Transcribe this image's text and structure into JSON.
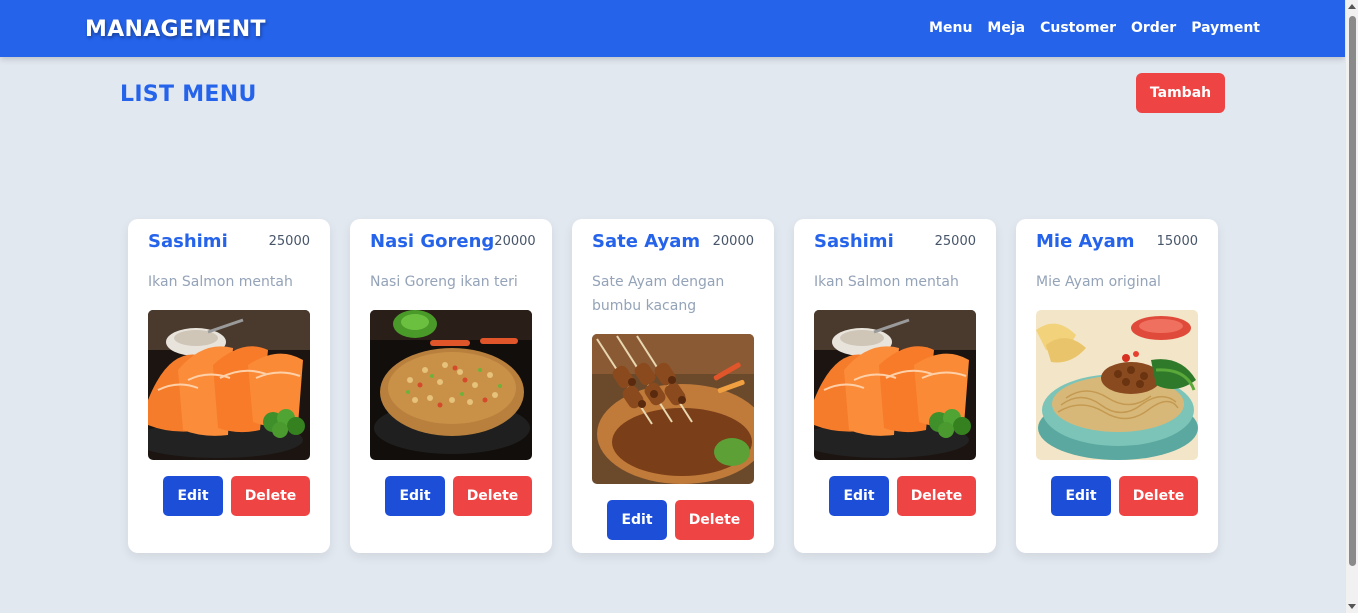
{
  "navbar": {
    "brand": "MANAGEMENT",
    "links": [
      "Menu",
      "Meja",
      "Customer",
      "Order",
      "Payment"
    ]
  },
  "page": {
    "title": "LIST MENU",
    "add_label": "Tambah"
  },
  "menu_items": [
    {
      "name": "Sashimi",
      "price": "25000",
      "description": "Ikan Salmon mentah",
      "image": "salmon-sashimi",
      "edit_label": "Edit",
      "delete_label": "Delete"
    },
    {
      "name": "Nasi Goreng",
      "price": "20000",
      "description": "Nasi Goreng ikan teri",
      "image": "fried-rice",
      "edit_label": "Edit",
      "delete_label": "Delete"
    },
    {
      "name": "Sate Ayam",
      "price": "20000",
      "description": "Sate Ayam dengan bumbu kacang",
      "image": "chicken-satay",
      "edit_label": "Edit",
      "delete_label": "Delete"
    },
    {
      "name": "Sashimi",
      "price": "25000",
      "description": "Ikan Salmon mentah",
      "image": "salmon-sashimi",
      "edit_label": "Edit",
      "delete_label": "Delete"
    },
    {
      "name": "Mie Ayam",
      "price": "15000",
      "description": "Mie Ayam original",
      "image": "chicken-noodles",
      "edit_label": "Edit",
      "delete_label": "Delete"
    }
  ],
  "colors": {
    "navbar": "#2563eb",
    "background": "#e2e8f0",
    "title": "#2563eb",
    "danger": "#ef4444",
    "edit": "#1d4ed8"
  }
}
